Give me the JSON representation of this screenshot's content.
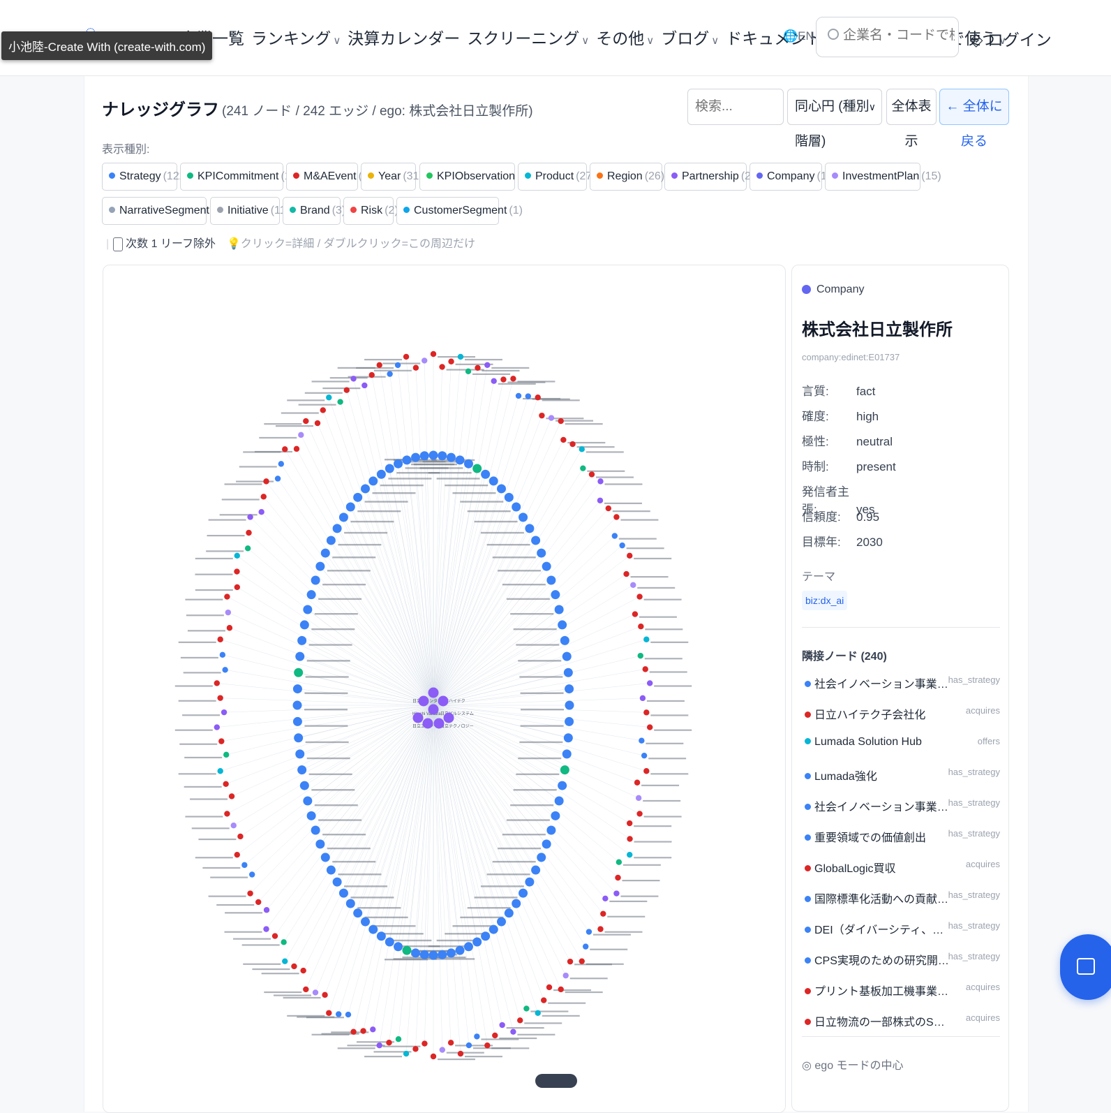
{
  "tooltip": "小池陸-Create With (create-with.com)",
  "nav": {
    "items": [
      {
        "label": "企業一覧",
        "chevron": false
      },
      {
        "label": "ランキング",
        "chevron": true
      },
      {
        "label": "決算カレンダー",
        "chevron": false
      },
      {
        "label": "スクリーニング",
        "chevron": true
      },
      {
        "label": "その他",
        "chevron": true
      },
      {
        "label": "ブログ",
        "chevron": true
      },
      {
        "label": "ドキュメント",
        "chevron": true
      },
      {
        "label": "API・MCP",
        "chevron": true
      },
      {
        "label": "AIで使う",
        "chevron": true
      }
    ],
    "lang": "EN",
    "search_placeholder": "企業名・コードで検索",
    "login": "ログイン"
  },
  "graph": {
    "title": "ナレッジグラフ",
    "subtitle": "(241 ノード / 242 エッジ / ego: 株式会社日立製作所)",
    "search_placeholder": "検索...",
    "layout_select": "同心円 (種別階層)",
    "show_all": "全体表示",
    "back_to_all": "← 全体に戻る",
    "filter_label": "表示種別:",
    "types": [
      {
        "name": "Strategy",
        "count": "(122)",
        "color": "#3b82f6"
      },
      {
        "name": "KPICommitment",
        "count": "(102)",
        "color": "#10b981"
      },
      {
        "name": "M&AEvent",
        "count": "(82)",
        "color": "#dc2626"
      },
      {
        "name": "Year",
        "count": "(31)",
        "color": "#eab308"
      },
      {
        "name": "KPIObservation",
        "count": "(31)",
        "color": "#22c55e"
      },
      {
        "name": "Product",
        "count": "(27)",
        "color": "#06b6d4"
      },
      {
        "name": "Region",
        "count": "(26)",
        "color": "#f97316"
      },
      {
        "name": "Partnership",
        "count": "(21)",
        "color": "#8b5cf6"
      },
      {
        "name": "Company",
        "count": "(17)",
        "color": "#6366f1"
      },
      {
        "name": "InvestmentPlan",
        "count": "(15)",
        "color": "#a78bfa"
      },
      {
        "name": "NarrativeSegment",
        "count": "(11)",
        "color": "#94a3b8"
      },
      {
        "name": "Initiative",
        "count": "(11)",
        "color": "#9ca3af"
      },
      {
        "name": "Brand",
        "count": "(3)",
        "color": "#14b8a6"
      },
      {
        "name": "Risk",
        "count": "(2)",
        "color": "#ef4444"
      },
      {
        "name": "CustomerSegment",
        "count": "(1)",
        "color": "#0ea5e9"
      }
    ],
    "exclude_leaf": "次数 1 リーフ除外",
    "hint": "💡クリック=詳細 / ダブルクリック=この周辺だけ",
    "center_labels": [
      "日立ヴァンタラ",
      "日立ハイテク",
      "Hitachi Vantara",
      "日立ビルシステム",
      "日立エナジー",
      "日立テクノロジー"
    ]
  },
  "detail": {
    "type": "Company",
    "type_color": "#6366f1",
    "name": "株式会社日立製作所",
    "id": "company:edinet:E01737",
    "attrs": [
      {
        "k": "言質:",
        "v": "fact"
      },
      {
        "k": "確度:",
        "v": "high"
      },
      {
        "k": "極性:",
        "v": "neutral"
      },
      {
        "k": "時制:",
        "v": "present"
      },
      {
        "k": "発信者主張:",
        "v": "yes"
      },
      {
        "k": "信頼度:",
        "v": "0.95"
      },
      {
        "k": "目標年:",
        "v": "2030"
      }
    ],
    "theme_label": "テーマ",
    "theme": "biz:dx_ai",
    "neighbors_title": "隣接ノード (240)",
    "neighbors": [
      {
        "label": "社会イノベーション事業の加速",
        "rel": "has_strategy",
        "color": "#3b82f6"
      },
      {
        "label": "日立ハイテク子会社化",
        "rel": "acquires",
        "color": "#dc2626"
      },
      {
        "label": "Lumada Solution Hub",
        "rel": "offers",
        "color": "#06b6d4"
      },
      {
        "label": "Lumada強化",
        "rel": "has_strategy",
        "color": "#3b82f6"
      },
      {
        "label": "社会イノベーション事業の高収益化",
        "rel": "has_strategy",
        "color": "#3b82f6"
      },
      {
        "label": "重要領域での価値創出",
        "rel": "has_strategy",
        "color": "#3b82f6"
      },
      {
        "label": "GlobalLogic買収",
        "rel": "acquires",
        "color": "#dc2626"
      },
      {
        "label": "国際標準化活動への貢献とグローバル...",
        "rel": "has_strategy",
        "color": "#3b82f6"
      },
      {
        "label": "DEI（ダイバーシティ、エクイティ&イ...",
        "rel": "has_strategy",
        "color": "#3b82f6"
      },
      {
        "label": "CPS実現のための研究開発強化",
        "rel": "has_strategy",
        "color": "#3b82f6"
      },
      {
        "label": "プリント基板加工機事業の投資ファンドへ...",
        "rel": "acquires",
        "color": "#dc2626"
      },
      {
        "label": "日立物流の一部株式のSGホールディング...",
        "rel": "acquires",
        "color": "#dc2626"
      }
    ],
    "ego_label": "ego モードの中心"
  }
}
